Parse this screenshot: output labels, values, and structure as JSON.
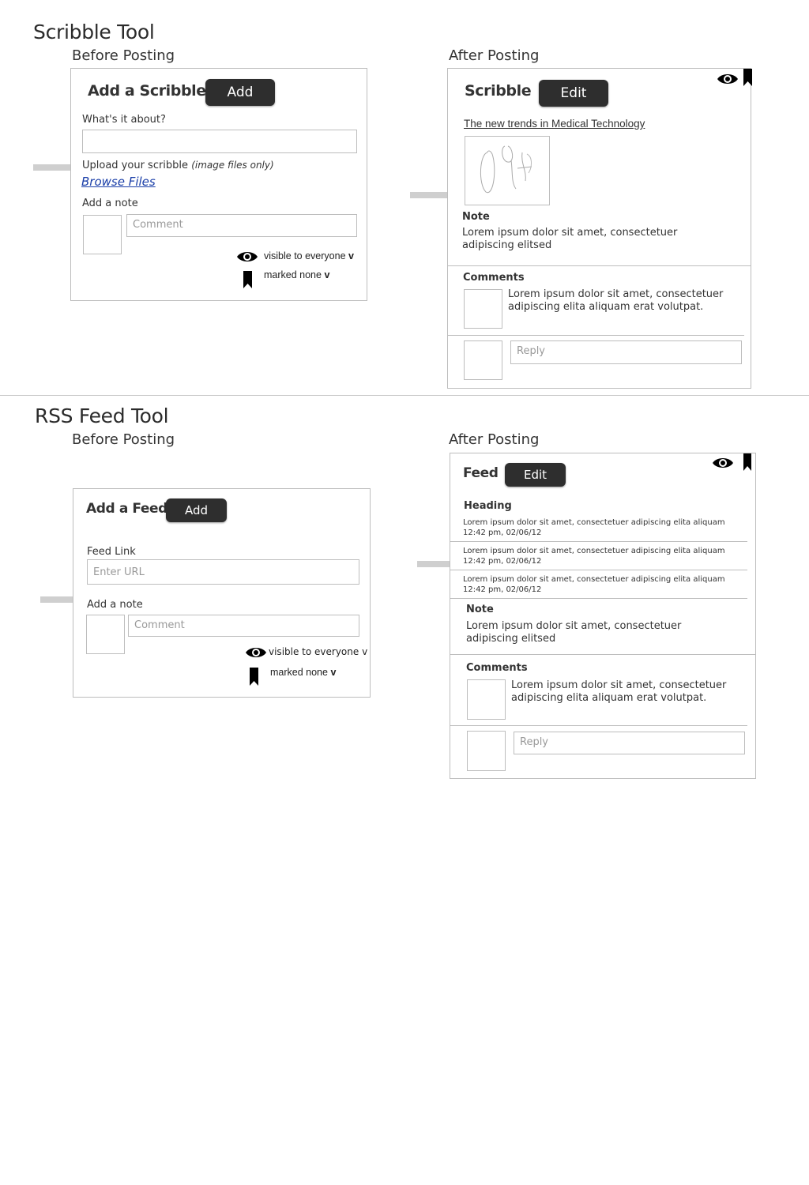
{
  "scribble": {
    "title": "Scribble Tool",
    "before_heading": "Before Posting",
    "after_heading": "After Posting",
    "form": {
      "title": "Add a Scribble",
      "add_label": "Add",
      "about_label": "What's it about?",
      "about_value": "",
      "upload_label": "Upload your scribble",
      "upload_hint": "(image files only)",
      "browse_label": "Browse Files",
      "note_label": "Add a note",
      "comment_placeholder": "Comment",
      "visibility": "visible to everyone",
      "marked": "marked none",
      "caret": "v"
    },
    "post": {
      "title": "Scribble",
      "edit_label": "Edit",
      "topic": "The new trends in Medical Technology",
      "note_heading": "Note",
      "note_text": "Lorem ipsum dolor sit amet, consectetuer adipiscing elitsed",
      "comments_heading": "Comments",
      "comment_text": "Lorem ipsum dolor sit amet, consectetuer adipiscing elita aliquam erat volutpat.",
      "reply_placeholder": "Reply"
    }
  },
  "rss": {
    "title": "RSS Feed Tool",
    "before_heading": "Before Posting",
    "after_heading": "After Posting",
    "form": {
      "title": "Add a Feed",
      "add_label": "Add",
      "link_label": "Feed Link",
      "url_placeholder": "Enter URL",
      "note_label": "Add a note",
      "comment_placeholder": "Comment",
      "visibility": "visible to everyone",
      "visibility_caret": "v",
      "marked": "marked none",
      "caret": "v"
    },
    "post": {
      "title": "Feed",
      "edit_label": "Edit",
      "heading": "Heading",
      "items": [
        {
          "text": "Lorem ipsum dolor sit amet, consectetuer adipiscing elita aliquam",
          "time": "12:42 pm, 02/06/12"
        },
        {
          "text": "Lorem ipsum dolor sit amet, consectetuer adipiscing elita aliquam",
          "time": "12:42 pm, 02/06/12"
        },
        {
          "text": "Lorem ipsum dolor sit amet, consectetuer adipiscing elita aliquam",
          "time": "12:42 pm, 02/06/12"
        }
      ],
      "note_heading": "Note",
      "note_text": "Lorem ipsum dolor sit amet, consectetuer adipiscing elitsed",
      "comments_heading": "Comments",
      "comment_text": "Lorem ipsum dolor sit amet, consectetuer adipiscing elita aliquam erat volutpat.",
      "reply_placeholder": "Reply"
    }
  },
  "icons": [
    "eye-icon",
    "bookmark-icon"
  ],
  "colors": {
    "button": "#2e2e2e",
    "border": "#bdbdbd",
    "link": "#1a3ea8",
    "connector": "#cfcfcf"
  }
}
